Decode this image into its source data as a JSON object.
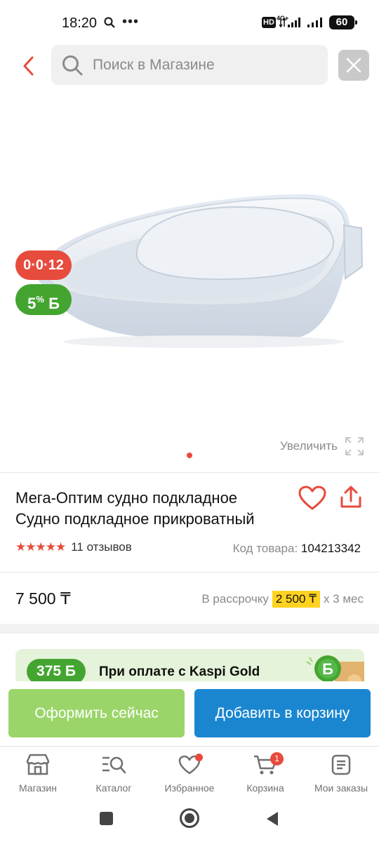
{
  "status_bar": {
    "time": "18:20",
    "more": "•••",
    "hd": "HD",
    "network": "4G+",
    "battery": "60"
  },
  "search": {
    "placeholder": "Поиск в Магазине"
  },
  "gallery": {
    "timer_badge": "0·0·12",
    "bonus_badge_percent": "5",
    "bonus_badge_sup": "%",
    "bonus_badge_currency": "Б",
    "zoom_label": "Увеличить",
    "slide_count": 1,
    "active_slide": 1
  },
  "product": {
    "title_line1": "Мега-Оптим судно подкладное",
    "title_line2": "Судно подкладное прикроватный",
    "rating_stars": 5,
    "stars_text": "★★★★★",
    "reviews": "11 отзывов",
    "sku_label": "Код товара:",
    "sku_value": "104213342",
    "price": "7 500 ₸",
    "installment_prefix": "В рассрочку",
    "installment_amount": "2 500 ₸",
    "installment_suffix": "х 3 мес"
  },
  "kaspi_banner": {
    "bonus": "375 Б",
    "text": "При оплате с Kaspi Gold"
  },
  "actions": {
    "buy_now": "Оформить сейчас",
    "add_to_cart": "Добавить в корзину"
  },
  "tabs": [
    {
      "label": "Магазин",
      "icon": "store-icon"
    },
    {
      "label": "Каталог",
      "icon": "catalog-search-icon"
    },
    {
      "label": "Избранное",
      "icon": "heart-icon"
    },
    {
      "label": "Корзина",
      "icon": "cart-icon",
      "badge": "1"
    },
    {
      "label": "Мои заказы",
      "icon": "orders-icon"
    }
  ],
  "colors": {
    "accent_red": "#e74b3c",
    "green": "#43a530",
    "blue": "#1a86d0",
    "light_green": "#9bd56a",
    "yellow": "#ffd21f"
  }
}
